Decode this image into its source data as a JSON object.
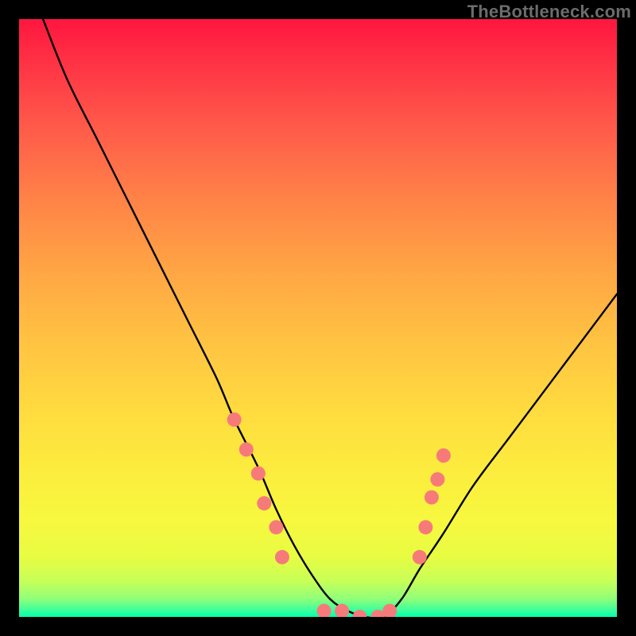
{
  "watermark": "TheBottleneck.com",
  "chart_data": {
    "type": "line",
    "title": "",
    "xlabel": "",
    "ylabel": "",
    "xlim": [
      0,
      100
    ],
    "ylim": [
      0,
      100
    ],
    "grid": false,
    "legend": false,
    "notes": "V-shaped bottleneck curve on a red-to-green vertical gradient; axes and ticks not labeled in image so values are normalized 0-100 estimates from pixel positions.",
    "series": [
      {
        "name": "bottleneck-curve",
        "color": "#000000",
        "x": [
          4,
          8,
          13,
          18,
          23,
          28,
          33,
          36,
          40,
          43,
          46,
          49,
          52,
          55,
          58,
          61,
          64,
          67,
          71,
          76,
          82,
          88,
          94,
          100
        ],
        "y": [
          100,
          90,
          80,
          70,
          60,
          50,
          40,
          33,
          25,
          18,
          12,
          7,
          3,
          1,
          0,
          0,
          3,
          8,
          14,
          22,
          30,
          38,
          46,
          54
        ]
      }
    ],
    "markers": {
      "name": "highlight-dots",
      "color": "#f77a7a",
      "radius_px": 9,
      "points_xy": [
        [
          36,
          33
        ],
        [
          38,
          28
        ],
        [
          40,
          24
        ],
        [
          41,
          19
        ],
        [
          43,
          15
        ],
        [
          44,
          10
        ],
        [
          51,
          1
        ],
        [
          54,
          1
        ],
        [
          57,
          0
        ],
        [
          60,
          0
        ],
        [
          62,
          1
        ],
        [
          67,
          10
        ],
        [
          68,
          15
        ],
        [
          69,
          20
        ],
        [
          70,
          23
        ],
        [
          71,
          27
        ]
      ]
    }
  }
}
